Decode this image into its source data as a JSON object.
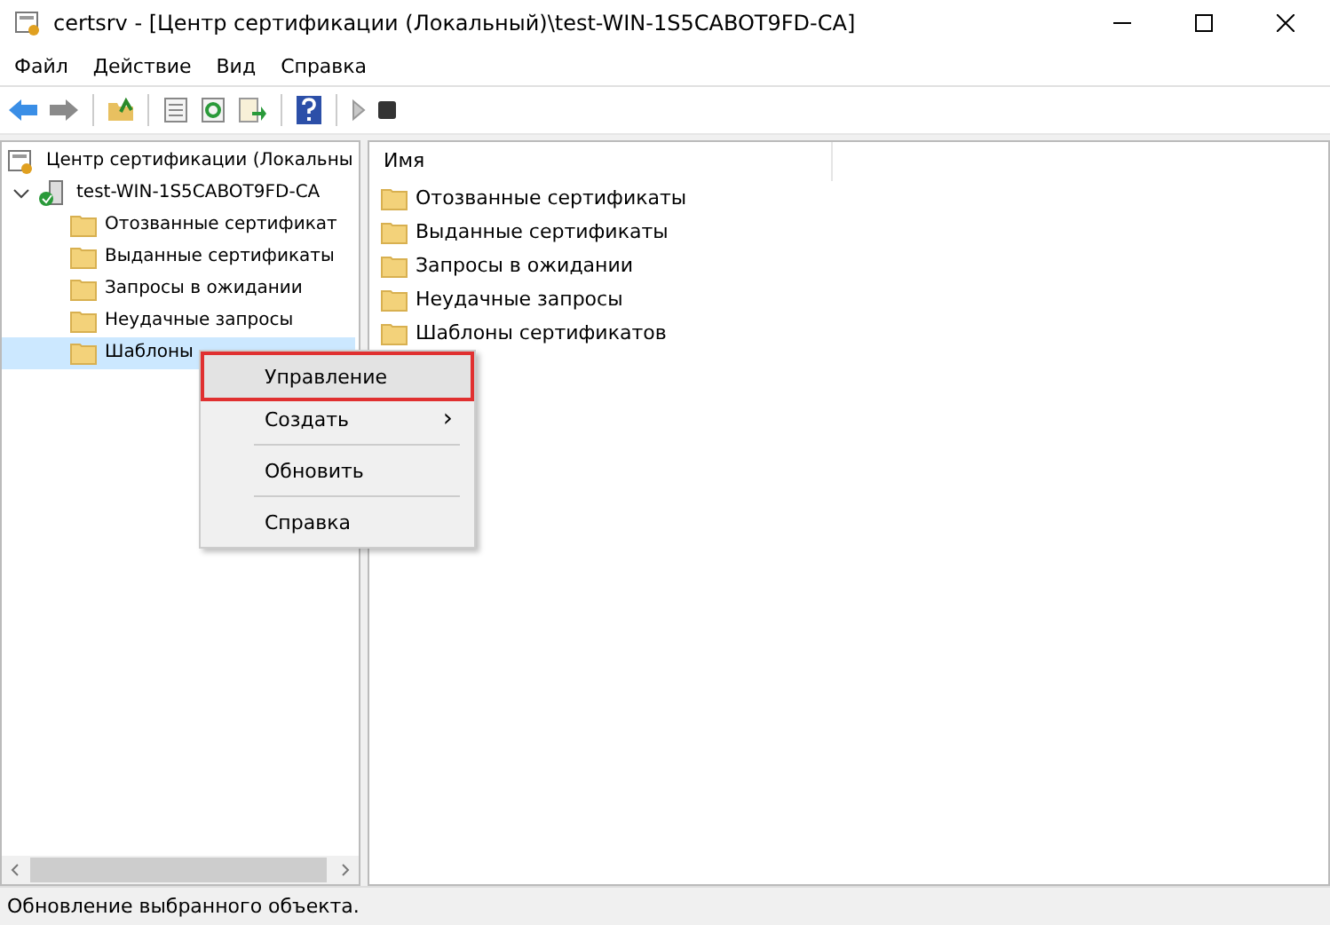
{
  "window": {
    "title": "certsrv - [Центр сертификации (Локальный)\\test-WIN-1S5CABOT9FD-CA]"
  },
  "menu_bar": [
    "Файл",
    "Действие",
    "Вид",
    "Справка"
  ],
  "tree": {
    "root": "Центр сертификации (Локальны",
    "items": [
      {
        "label": "test-WIN-1S5CABOT9FD-CA",
        "expanded": true,
        "selected": false,
        "children": [
          {
            "label": "Отозванные сертификат",
            "selected": false
          },
          {
            "label": "Выданные сертификаты",
            "selected": false
          },
          {
            "label": "Запросы в ожидании",
            "selected": false
          },
          {
            "label": "Неудачные запросы",
            "selected": false
          },
          {
            "label": "Шаблоны",
            "selected": true
          }
        ]
      }
    ]
  },
  "list": {
    "columns": [
      "Имя"
    ],
    "rows": [
      "Отозванные сертификаты",
      "Выданные сертификаты",
      "Запросы в ожидании",
      "Неудачные запросы",
      "Шаблоны сертификатов"
    ]
  },
  "context_menu": [
    {
      "label": "Управление",
      "highlighted": true
    },
    {
      "label": "Создать",
      "highlighted": false,
      "arrow": "›"
    },
    {
      "label": "Обновить",
      "highlighted": false
    },
    {
      "label": "Справка",
      "highlighted": false
    }
  ],
  "status_bar": "Обновление выбранного объекта."
}
